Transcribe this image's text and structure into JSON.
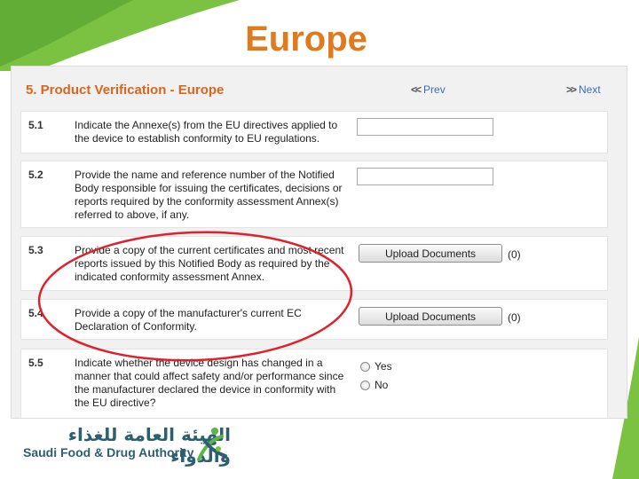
{
  "slide": {
    "title": "Europe"
  },
  "panel": {
    "section_title": "5. Product Verification - Europe",
    "nav_prev": "Prev",
    "nav_next": "Next",
    "rows": [
      {
        "number": "5.1",
        "text": "Indicate the Annexe(s) from the EU directives applied to the device to establish conformity to EU regulations.",
        "input_value": ""
      },
      {
        "number": "5.2",
        "text": "Provide the name and reference number of the Notified Body responsible for issuing the certificates, decisions or reports required by the conformity assessment Annex(s) referred to above, if any.",
        "input_value": ""
      },
      {
        "number": "5.3",
        "text": "Provide a copy of the current certificates and most recent reports issued by this Notified Body as required by the indicated conformity assessment Annex.",
        "button_label": "Upload Documents",
        "count": "(0)"
      },
      {
        "number": "5.4",
        "text": "Provide a copy of the manufacturer's current EC Declaration of Conformity.",
        "button_label": "Upload Documents",
        "count": "(0)"
      },
      {
        "number": "5.5",
        "text": "Indicate whether the device design has changed in a manner that could affect safety and/or performance since the manufacturer declared the device in conformity with the EU directive?",
        "option_yes": "Yes",
        "option_no": "No"
      }
    ]
  },
  "footer": {
    "logo_arabic": "الهيئة العامة للغذاء والدواء",
    "logo_english": "Saudi Food & Drug Authority"
  },
  "colors": {
    "title": "#e07a1f",
    "section_title": "#d9661e",
    "link": "#3a6db5",
    "annotation": "#e0202a",
    "brand_green": "#5bb548",
    "brand_teal": "#2c5f6f"
  }
}
